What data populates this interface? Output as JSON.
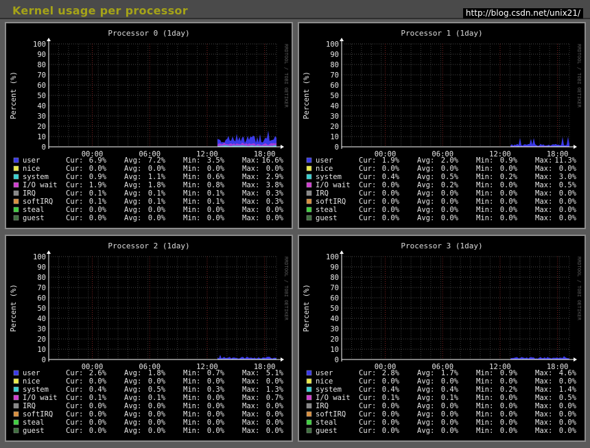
{
  "header": {
    "title": "Kernel usage per processor",
    "watermark": "http://blog.csdn.net/unix21/"
  },
  "side_text": "RRDTOOL / TOBI OETIKER",
  "stat_labels": {
    "cur": "Cur:",
    "avg": "Avg:",
    "min": "Min:",
    "max": "Max:"
  },
  "colors": {
    "user": "#3a3ae8",
    "nice": "#e8e84a",
    "system": "#3ad0d0",
    "io_wait": "#d040d0",
    "irq": "#888888",
    "softirq": "#d89040",
    "steal": "#40d040",
    "guest": "#407040"
  },
  "chart_data": [
    {
      "type": "area",
      "title": "Processor 0  (1day)",
      "ylabel": "Percent (%)",
      "ylim": [
        0,
        100
      ],
      "yticks": [
        "0",
        "10",
        "20",
        "30",
        "40",
        "50",
        "60",
        "70",
        "80",
        "90",
        "100"
      ],
      "xticks": [
        "00:00",
        "06:00",
        "12:00",
        "18:00"
      ],
      "grid": true,
      "series": [
        {
          "name": "user",
          "color": "#3a3ae8",
          "cur": "6.9%",
          "avg": "7.2%",
          "min": "3.5%",
          "max": "16.6%"
        },
        {
          "name": "nice",
          "color": "#e8e84a",
          "cur": "0.0%",
          "avg": "0.0%",
          "min": "0.0%",
          "max": "0.0%"
        },
        {
          "name": "system",
          "color": "#3ad0d0",
          "cur": "0.9%",
          "avg": "1.1%",
          "min": "0.6%",
          "max": "2.9%"
        },
        {
          "name": "I/O wait",
          "color": "#d040d0",
          "cur": "1.9%",
          "avg": "1.8%",
          "min": "0.8%",
          "max": "3.8%"
        },
        {
          "name": "IRQ",
          "color": "#888888",
          "cur": "0.1%",
          "avg": "0.1%",
          "min": "0.1%",
          "max": "0.3%"
        },
        {
          "name": "softIRQ",
          "color": "#d89040",
          "cur": "0.1%",
          "avg": "0.1%",
          "min": "0.1%",
          "max": "0.3%"
        },
        {
          "name": "steal",
          "color": "#40d040",
          "cur": "0.0%",
          "avg": "0.0%",
          "min": "0.0%",
          "max": "0.0%"
        },
        {
          "name": "guest",
          "color": "#407040",
          "cur": "0.0%",
          "avg": "0.0%",
          "min": "0.0%",
          "max": "0.0%"
        }
      ]
    },
    {
      "type": "area",
      "title": "Processor 1  (1day)",
      "ylabel": "Percent (%)",
      "ylim": [
        0,
        100
      ],
      "yticks": [
        "0",
        "10",
        "20",
        "30",
        "40",
        "50",
        "60",
        "70",
        "80",
        "90",
        "100"
      ],
      "xticks": [
        "00:00",
        "06:00",
        "12:00",
        "18:00"
      ],
      "grid": true,
      "series": [
        {
          "name": "user",
          "color": "#3a3ae8",
          "cur": "1.9%",
          "avg": "2.0%",
          "min": "0.9%",
          "max": "11.3%"
        },
        {
          "name": "nice",
          "color": "#e8e84a",
          "cur": "0.0%",
          "avg": "0.0%",
          "min": "0.0%",
          "max": "0.0%"
        },
        {
          "name": "system",
          "color": "#3ad0d0",
          "cur": "0.4%",
          "avg": "0.5%",
          "min": "0.2%",
          "max": "3.0%"
        },
        {
          "name": "I/O wait",
          "color": "#d040d0",
          "cur": "0.0%",
          "avg": "0.2%",
          "min": "0.0%",
          "max": "0.5%"
        },
        {
          "name": "IRQ",
          "color": "#888888",
          "cur": "0.0%",
          "avg": "0.0%",
          "min": "0.0%",
          "max": "0.0%"
        },
        {
          "name": "softIRQ",
          "color": "#d89040",
          "cur": "0.0%",
          "avg": "0.0%",
          "min": "0.0%",
          "max": "0.0%"
        },
        {
          "name": "steal",
          "color": "#40d040",
          "cur": "0.0%",
          "avg": "0.0%",
          "min": "0.0%",
          "max": "0.0%"
        },
        {
          "name": "guest",
          "color": "#407040",
          "cur": "0.0%",
          "avg": "0.0%",
          "min": "0.0%",
          "max": "0.0%"
        }
      ]
    },
    {
      "type": "area",
      "title": "Processor 2  (1day)",
      "ylabel": "Percent (%)",
      "ylim": [
        0,
        100
      ],
      "yticks": [
        "0",
        "10",
        "20",
        "30",
        "40",
        "50",
        "60",
        "70",
        "80",
        "90",
        "100"
      ],
      "xticks": [
        "00:00",
        "06:00",
        "12:00",
        "18:00"
      ],
      "grid": true,
      "series": [
        {
          "name": "user",
          "color": "#3a3ae8",
          "cur": "2.6%",
          "avg": "1.8%",
          "min": "0.7%",
          "max": "5.1%"
        },
        {
          "name": "nice",
          "color": "#e8e84a",
          "cur": "0.0%",
          "avg": "0.0%",
          "min": "0.0%",
          "max": "0.0%"
        },
        {
          "name": "system",
          "color": "#3ad0d0",
          "cur": "0.4%",
          "avg": "0.5%",
          "min": "0.3%",
          "max": "1.3%"
        },
        {
          "name": "I/O wait",
          "color": "#d040d0",
          "cur": "0.1%",
          "avg": "0.1%",
          "min": "0.0%",
          "max": "0.7%"
        },
        {
          "name": "IRQ",
          "color": "#888888",
          "cur": "0.0%",
          "avg": "0.0%",
          "min": "0.0%",
          "max": "0.0%"
        },
        {
          "name": "softIRQ",
          "color": "#d89040",
          "cur": "0.0%",
          "avg": "0.0%",
          "min": "0.0%",
          "max": "0.0%"
        },
        {
          "name": "steal",
          "color": "#40d040",
          "cur": "0.0%",
          "avg": "0.0%",
          "min": "0.0%",
          "max": "0.0%"
        },
        {
          "name": "guest",
          "color": "#407040",
          "cur": "0.0%",
          "avg": "0.0%",
          "min": "0.0%",
          "max": "0.0%"
        }
      ]
    },
    {
      "type": "area",
      "title": "Processor 3  (1day)",
      "ylabel": "Percent (%)",
      "ylim": [
        0,
        100
      ],
      "yticks": [
        "0",
        "10",
        "20",
        "30",
        "40",
        "50",
        "60",
        "70",
        "80",
        "90",
        "100"
      ],
      "xticks": [
        "00:00",
        "06:00",
        "12:00",
        "18:00"
      ],
      "grid": true,
      "series": [
        {
          "name": "user",
          "color": "#3a3ae8",
          "cur": "2.8%",
          "avg": "1.7%",
          "min": "0.9%",
          "max": "4.6%"
        },
        {
          "name": "nice",
          "color": "#e8e84a",
          "cur": "0.0%",
          "avg": "0.0%",
          "min": "0.0%",
          "max": "0.0%"
        },
        {
          "name": "system",
          "color": "#3ad0d0",
          "cur": "0.4%",
          "avg": "0.4%",
          "min": "0.2%",
          "max": "1.4%"
        },
        {
          "name": "I/O wait",
          "color": "#d040d0",
          "cur": "0.1%",
          "avg": "0.1%",
          "min": "0.0%",
          "max": "0.5%"
        },
        {
          "name": "IRQ",
          "color": "#888888",
          "cur": "0.0%",
          "avg": "0.0%",
          "min": "0.0%",
          "max": "0.0%"
        },
        {
          "name": "softIRQ",
          "color": "#d89040",
          "cur": "0.0%",
          "avg": "0.0%",
          "min": "0.0%",
          "max": "0.0%"
        },
        {
          "name": "steal",
          "color": "#40d040",
          "cur": "0.0%",
          "avg": "0.0%",
          "min": "0.0%",
          "max": "0.0%"
        },
        {
          "name": "guest",
          "color": "#407040",
          "cur": "0.0%",
          "avg": "0.0%",
          "min": "0.0%",
          "max": "0.0%"
        }
      ]
    }
  ]
}
